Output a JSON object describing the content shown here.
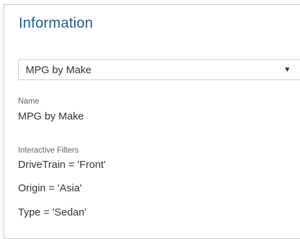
{
  "panel": {
    "title": "Information"
  },
  "selector": {
    "selected": "MPG by Make",
    "arrow_icon": "triangle-down-icon"
  },
  "name_section": {
    "label": "Name",
    "value": "MPG by Make"
  },
  "filters_section": {
    "label": "Interactive Filters",
    "filters": [
      "DriveTrain = 'Front'",
      "Origin = 'Asia'",
      "Type = 'Sedan'"
    ]
  },
  "colors": {
    "title": "#1b5e8f",
    "text": "#333333",
    "label": "#666666",
    "border": "#c9c9c9"
  }
}
